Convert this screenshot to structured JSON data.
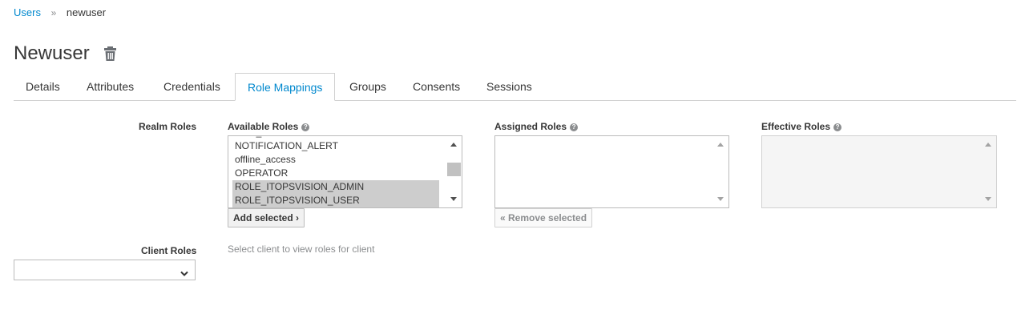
{
  "breadcrumb": {
    "parent": "Users",
    "separator": "»",
    "current": "newuser"
  },
  "page": {
    "title": "Newuser"
  },
  "tabs": [
    {
      "label": "Details"
    },
    {
      "label": "Attributes"
    },
    {
      "label": "Credentials"
    },
    {
      "label": "Role Mappings",
      "active": true
    },
    {
      "label": "Groups"
    },
    {
      "label": "Consents"
    },
    {
      "label": "Sessions"
    }
  ],
  "realm_roles": {
    "label": "Realm Roles",
    "available": {
      "label": "Available Roles",
      "items": [
        {
          "name": "NOTIFICATION_ALERT",
          "selected": false
        },
        {
          "name": "offline_access",
          "selected": false
        },
        {
          "name": "OPERATOR",
          "selected": false
        },
        {
          "name": "ROLE_ITOPSVISION_ADMIN",
          "selected": true
        },
        {
          "name": "ROLE_ITOPSVISION_USER",
          "selected": true
        }
      ],
      "add_button": "Add selected ›"
    },
    "assigned": {
      "label": "Assigned Roles",
      "items": [],
      "remove_button": "« Remove selected"
    },
    "effective": {
      "label": "Effective Roles",
      "items": []
    }
  },
  "client_roles": {
    "label": "Client Roles",
    "hint": "Select client to view roles for client",
    "selected_value": ""
  },
  "colors": {
    "link": "#0088ce",
    "selection": "#cdcdcd",
    "text": "#363636"
  }
}
